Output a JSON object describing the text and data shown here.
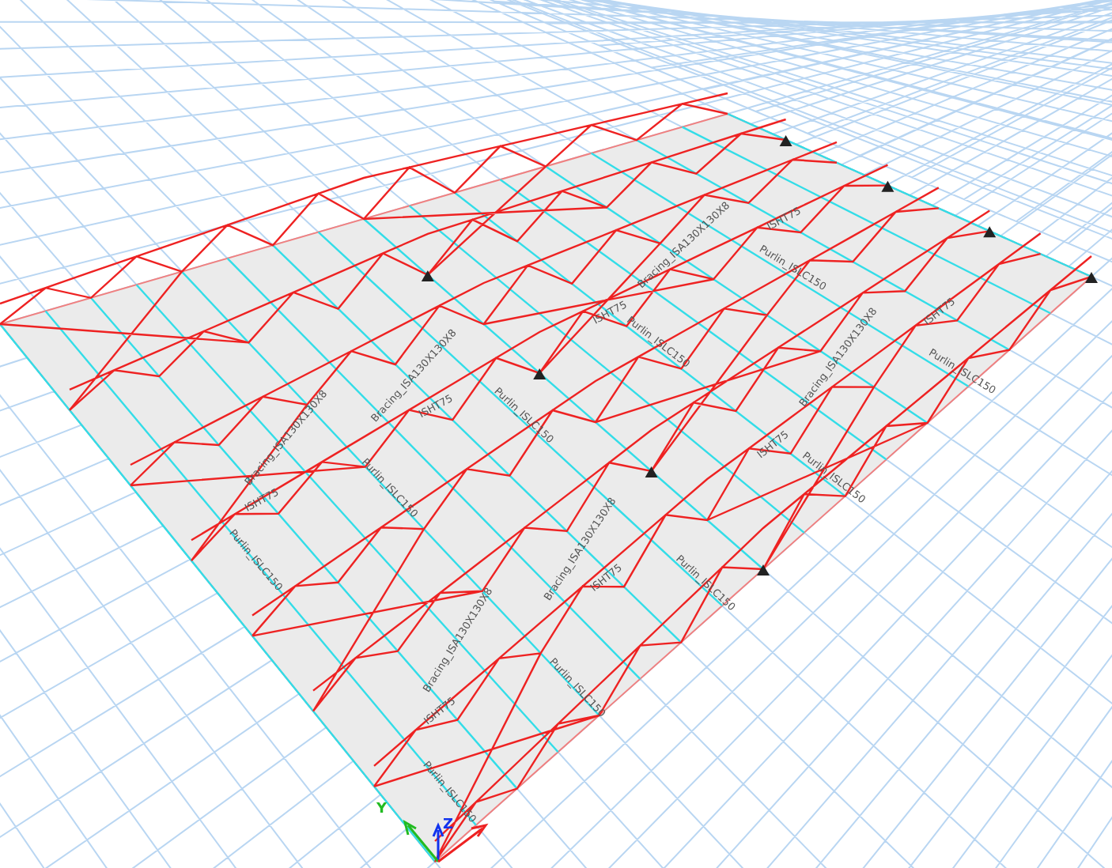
{
  "viewport": {
    "axis_labels": [
      {
        "text": "Y",
        "kind": "y"
      },
      {
        "text": "Z",
        "kind": "z"
      }
    ],
    "purlin_labels": [
      "Purlin_ISLC150",
      "Purlin_ISLC150",
      "Purlin_ISLC150",
      "Purlin_ISLC150",
      "Purlin_ISLC150",
      "Purlin_ISLC150",
      "Purlin_ISLC150",
      "Purlin_ISLC150",
      "Purlin_ISLC150",
      "Purlin_ISLC150"
    ],
    "bracing_labels": [
      "Bracing_ISA130X130X8",
      "Bracing_ISA130X130X8",
      "Bracing_ISA130X130X8",
      "Bracing_ISA130X130X8",
      "Bracing_ISA130X130X8",
      "Bracing_ISA130X130X8"
    ],
    "truss_labels": [
      "ISHT75",
      "ISHT75",
      "ISHT75",
      "ISHT75",
      "ISHT75",
      "ISHT75",
      "ISHT75",
      "ISHT75"
    ]
  }
}
